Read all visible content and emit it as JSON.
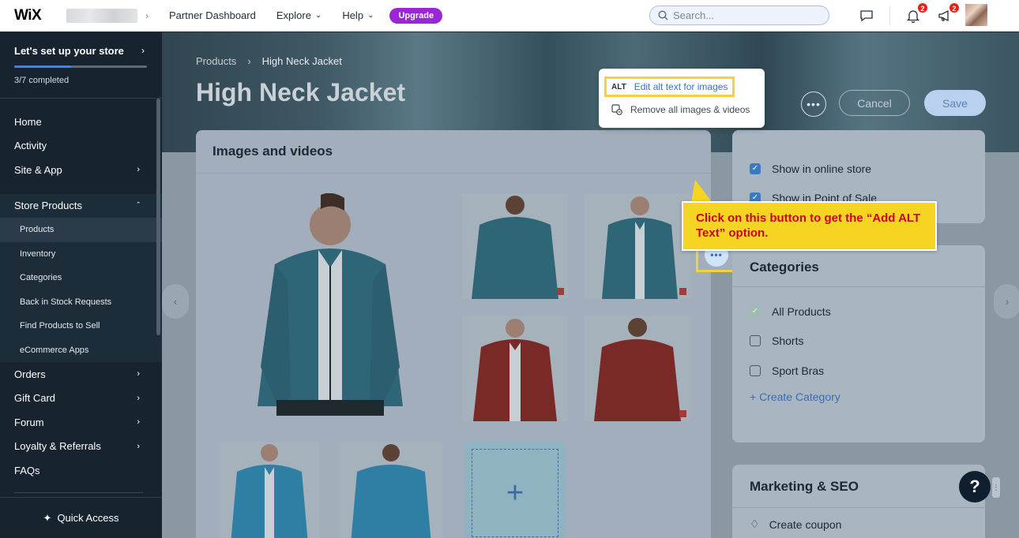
{
  "topbar": {
    "logo": "WiX",
    "nav": {
      "partner_dashboard": "Partner Dashboard",
      "explore": "Explore",
      "help": "Help",
      "upgrade": "Upgrade"
    },
    "search_placeholder": "Search...",
    "notifications_count": "2",
    "announcements_count": "2"
  },
  "sidebar": {
    "setup_title": "Let's set up your store",
    "setup_progress_text": "3/7 completed",
    "setup_progress_fraction": 0.43,
    "items": {
      "home": "Home",
      "activity": "Activity",
      "site_app": "Site & App",
      "store_products": "Store Products",
      "orders": "Orders",
      "gift_card": "Gift Card",
      "forum": "Forum",
      "loyalty": "Loyalty & Referrals",
      "faqs": "FAQs"
    },
    "store_sub": {
      "products": "Products",
      "inventory": "Inventory",
      "categories": "Categories",
      "back_in_stock": "Back in Stock Requests",
      "find_products": "Find Products to Sell",
      "ecommerce_apps": "eCommerce Apps"
    },
    "quick_access": "Quick Access"
  },
  "page": {
    "breadcrumb_root": "Products",
    "breadcrumb_current": "High Neck Jacket",
    "title": "High Neck Jacket",
    "cancel": "Cancel",
    "save": "Save"
  },
  "images_card": {
    "title": "Images and videos"
  },
  "menu": {
    "alt_tag": "ALT",
    "edit_alt": "Edit alt text for images",
    "remove_all": "Remove all images & videos"
  },
  "callout": {
    "text": "Click on this button to get the “Add ALT Text” option."
  },
  "visibility": {
    "show_online": "Show in online store",
    "show_pos": "Show in Point of Sale"
  },
  "categories": {
    "title": "Categories",
    "items": [
      "All Products",
      "Shorts",
      "Sport Bras"
    ],
    "create": "+ Create Category"
  },
  "seo": {
    "title": "Marketing & SEO",
    "create_coupon": "Create coupon"
  },
  "colors": {
    "accent": "#3b82f6",
    "upgrade": "#9a27d5",
    "highlight": "#f5d13a",
    "callout_text": "#d0021b"
  }
}
